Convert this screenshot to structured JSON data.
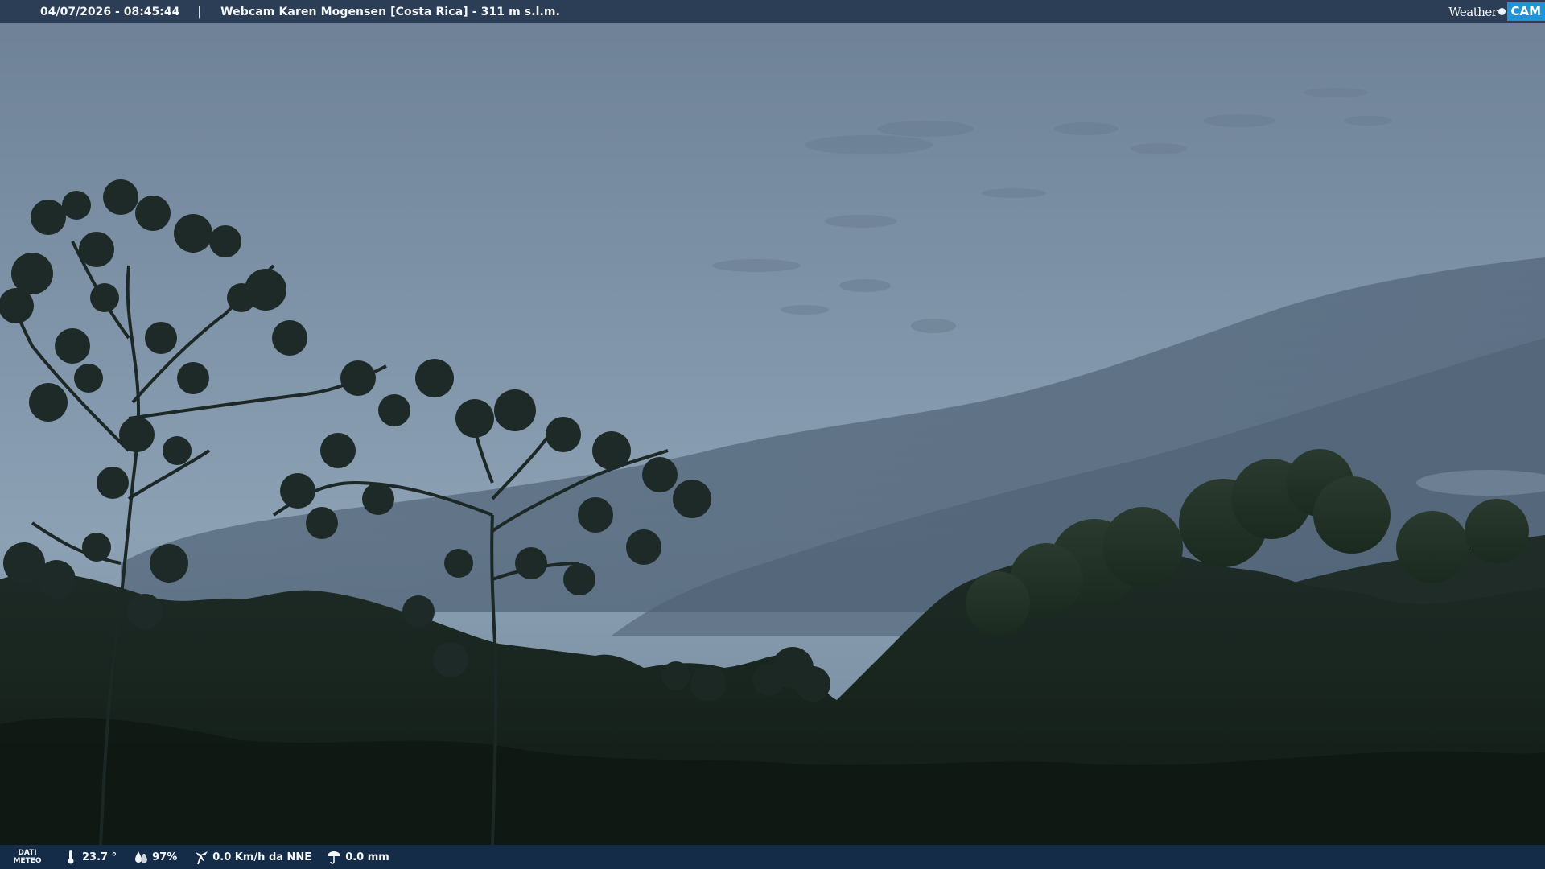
{
  "header": {
    "datetime": "04/07/2026 - 08:45:44",
    "separator": "|",
    "station": "Webcam Karen Mogensen [Costa Rica]  - 311 m s.l.m."
  },
  "brand": {
    "weather": "Weather",
    "cam": "CAM"
  },
  "meteo": {
    "label_line1": "DATI",
    "label_line2": "METEO",
    "temperature": "23.7 °",
    "humidity": "97%",
    "wind": "0.0 Km/h da NNE",
    "rain": "0.0 mm"
  },
  "icons": {
    "temperature": "thermometer-icon",
    "humidity": "humidity-drop-icon",
    "wind": "wind-icon",
    "rain": "rain-icon"
  },
  "colors": {
    "header_bar": "#26384f",
    "footer_bar": "#163052",
    "brand_accent": "#1d95d6"
  }
}
